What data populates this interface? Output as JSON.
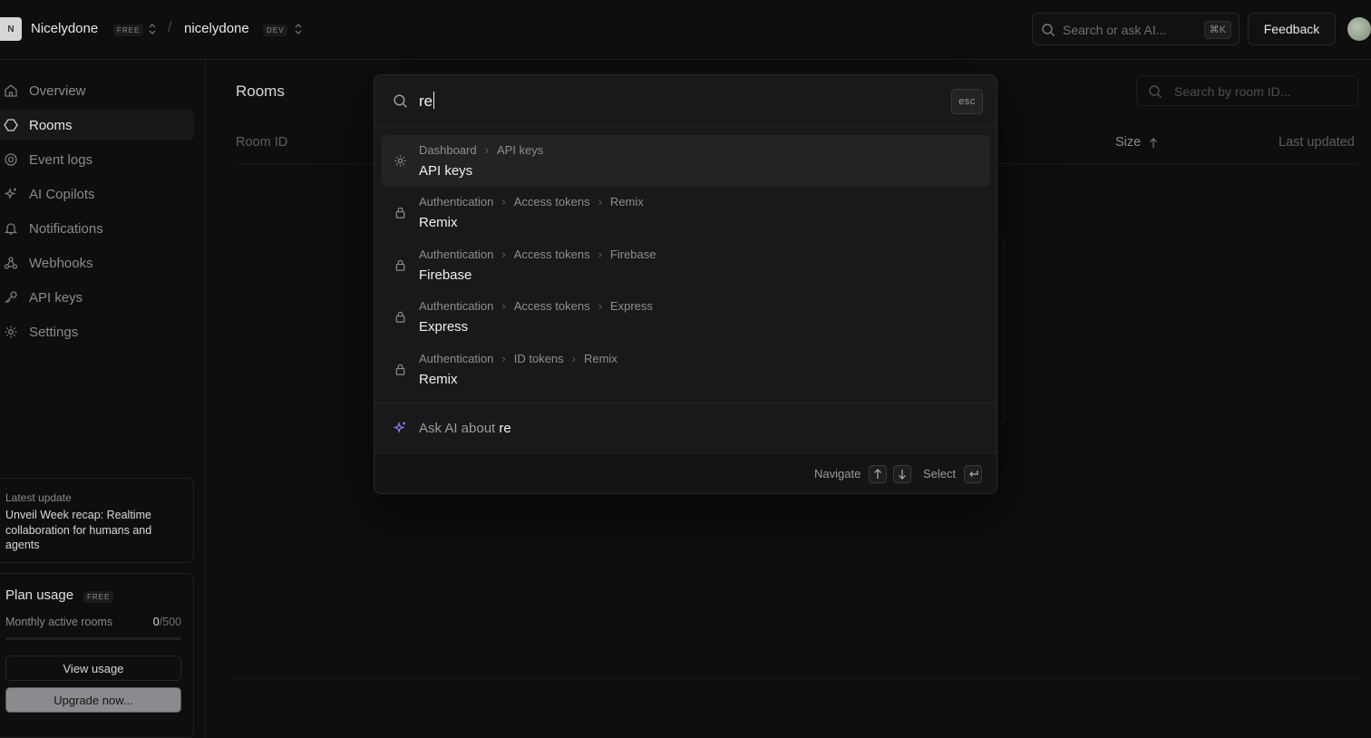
{
  "topbar": {
    "org_initial": "N",
    "org_name": "Nicelydone",
    "org_plan_badge": "FREE",
    "separator": "/",
    "project_name": "nicelydone",
    "project_env_badge": "DEV",
    "search_placeholder": "Search or ask AI...",
    "search_shortcut": "⌘K",
    "feedback_label": "Feedback"
  },
  "sidebar": {
    "items": [
      {
        "label": "Overview",
        "icon": "home-icon",
        "active": false
      },
      {
        "label": "Rooms",
        "icon": "rooms-icon",
        "active": true
      },
      {
        "label": "Event logs",
        "icon": "event-logs-icon",
        "active": false
      },
      {
        "label": "AI Copilots",
        "icon": "sparkles-icon",
        "active": false
      },
      {
        "label": "Notifications",
        "icon": "bell-icon",
        "active": false
      },
      {
        "label": "Webhooks",
        "icon": "webhooks-icon",
        "active": false
      },
      {
        "label": "API keys",
        "icon": "key-icon",
        "active": false
      },
      {
        "label": "Settings",
        "icon": "gear-icon",
        "active": false
      }
    ],
    "update": {
      "label": "Latest update",
      "title": "Unveil Week recap: Realtime collaboration for humans and agents"
    },
    "plan": {
      "title": "Plan usage",
      "badge": "FREE",
      "metric_label": "Monthly active rooms",
      "metric_value": "0",
      "metric_limit": "/500",
      "usage_fraction": 0,
      "view_usage_label": "View usage",
      "upgrade_label": "Upgrade now..."
    }
  },
  "main": {
    "title": "Rooms",
    "search_placeholder": "Search by room ID...",
    "columns": {
      "room_id": "Room ID",
      "size": "Size",
      "last_updated": "Last updated"
    }
  },
  "palette": {
    "query": "re",
    "esc_label": "esc",
    "results": [
      {
        "icon": "gear-icon",
        "crumbs": [
          "Dashboard",
          "API keys"
        ],
        "title": "API keys",
        "selected": true
      },
      {
        "icon": "lock-icon",
        "crumbs": [
          "Authentication",
          "Access tokens",
          "Remix"
        ],
        "title": "Remix",
        "selected": false
      },
      {
        "icon": "lock-icon",
        "crumbs": [
          "Authentication",
          "Access tokens",
          "Firebase"
        ],
        "title": "Firebase",
        "selected": false
      },
      {
        "icon": "lock-icon",
        "crumbs": [
          "Authentication",
          "Access tokens",
          "Express"
        ],
        "title": "Express",
        "selected": false
      },
      {
        "icon": "lock-icon",
        "crumbs": [
          "Authentication",
          "ID tokens",
          "Remix"
        ],
        "title": "Remix",
        "selected": false
      }
    ],
    "ask_ai_prefix": "Ask AI about ",
    "ask_ai_query": "re",
    "footer": {
      "navigate_label": "Navigate",
      "select_label": "Select"
    }
  },
  "colors": {
    "background": "#0e0e0f",
    "palette_bg": "#19191b",
    "ai_accent": "#8e7cf0",
    "upgrade_button": "#8b8b8f"
  }
}
